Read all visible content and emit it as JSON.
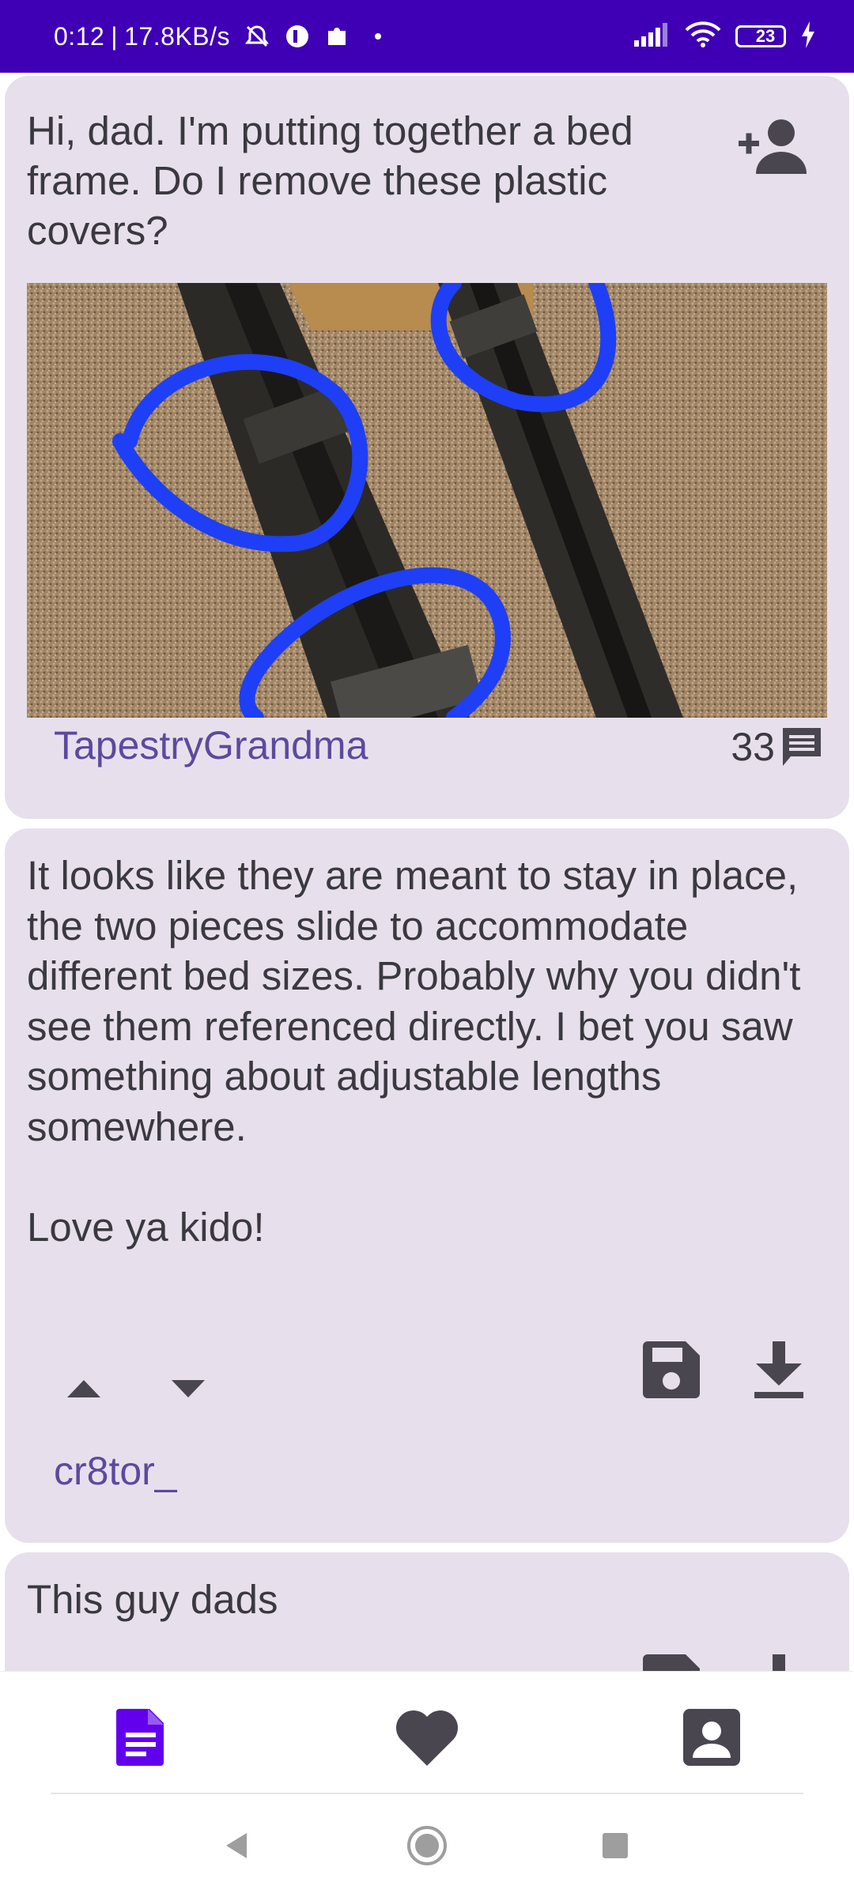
{
  "status_bar": {
    "time": "0:12",
    "network_speed": "17.8KB/s",
    "separator": "|",
    "battery_level": "23",
    "battery_fill_fraction": 0.23,
    "icons": [
      "alarm-off-icon",
      "app-notification-icon",
      "puzzle-icon",
      "dot-icon",
      "signal-icon",
      "wifi-icon",
      "battery-icon",
      "charging-icon"
    ]
  },
  "post": {
    "title": "Hi, dad. I'm putting together a bed frame. Do I remove these plastic covers?",
    "author": "TapestryGrandma",
    "comment_count": "33",
    "image_icon": "photo-of-bed-frame-rails-with-circled-plastic-covers",
    "action_icon": "add-user-icon"
  },
  "comments": [
    {
      "text": "It looks like they are meant to stay in place, the two pieces slide to accommodate different bed sizes. Probably why you didn't see them referenced directly. I bet you saw something about adjustable lengths somewhere.\n\nLove ya kido!",
      "author": "cr8tor_",
      "actions": [
        "upvote-icon",
        "downvote-icon",
        "save-icon",
        "download-icon"
      ]
    },
    {
      "text": "This guy dads",
      "actions": [
        "save-icon",
        "download-icon"
      ]
    }
  ],
  "bottom_nav": {
    "items": [
      {
        "icon": "posts-icon",
        "selected": true
      },
      {
        "icon": "heart-icon",
        "selected": false
      },
      {
        "icon": "profile-icon",
        "selected": false
      }
    ]
  },
  "system_nav": [
    "back-icon",
    "home-icon",
    "recents-icon"
  ],
  "colors": {
    "status_bar": "#3f00b5",
    "card_background": "#e7e0ec",
    "author": "#5b4a9e",
    "nav_selected": "#6200ee",
    "icon": "#4a4650",
    "circle_annotation": "#1e3ff5"
  }
}
